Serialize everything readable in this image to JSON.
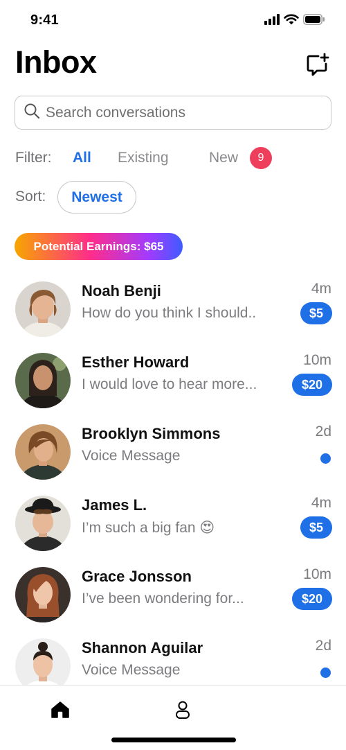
{
  "status_bar": {
    "time": "9:41",
    "icons": [
      "signal-icon",
      "wifi-icon",
      "battery-icon"
    ]
  },
  "header": {
    "title": "Inbox",
    "compose_icon": "new-message-icon"
  },
  "search": {
    "placeholder": "Search conversations",
    "value": ""
  },
  "filter": {
    "label": "Filter:",
    "tabs": [
      {
        "label": "All",
        "active": true
      },
      {
        "label": "Existing",
        "active": false
      },
      {
        "label": "New",
        "active": false,
        "badge": "9"
      }
    ]
  },
  "sort": {
    "label": "Sort:",
    "value": "Newest"
  },
  "earnings": {
    "label": "Potential Earnings: $65"
  },
  "conversations": [
    {
      "name": "Noah Benji",
      "preview": "How do you think I should..",
      "time": "4m",
      "amount": "$5",
      "unread": false
    },
    {
      "name": "Esther Howard",
      "preview": "I would love to hear more...",
      "time": "10m",
      "amount": "$20",
      "unread": false
    },
    {
      "name": "Brooklyn Simmons",
      "preview": "Voice Message",
      "time": "2d",
      "amount": "",
      "unread": true
    },
    {
      "name": "James L.",
      "preview": "I’m such a big fan 😍",
      "time": "4m",
      "amount": "$5",
      "unread": false
    },
    {
      "name": "Grace Jonsson",
      "preview": "I’ve been wondering for...",
      "time": "10m",
      "amount": "$20",
      "unread": false
    },
    {
      "name": "Shannon Aguilar",
      "preview": "Voice Message",
      "time": "2d",
      "amount": "",
      "unread": true
    }
  ],
  "tab_bar": {
    "items": [
      "home-icon",
      "profile-icon"
    ],
    "active": "home-icon"
  },
  "colors": {
    "accent": "#1f6fe6",
    "badge_red": "#ef3e5c",
    "muted_text": "#7c7c80"
  }
}
